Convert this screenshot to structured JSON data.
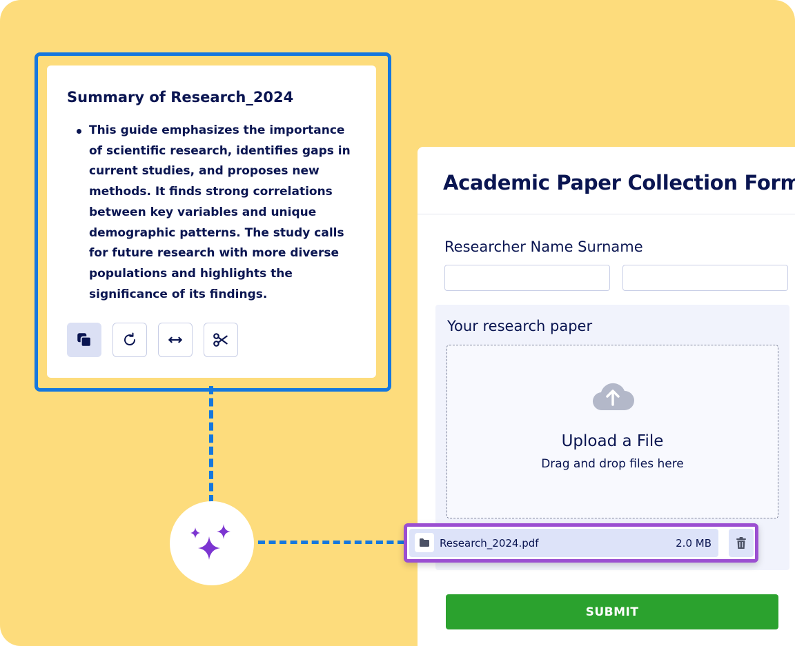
{
  "summary": {
    "title": "Summary of Research_2024",
    "bullets": [
      "This guide emphasizes the importance of scientific research, identifies gaps in current studies, and proposes new methods. It finds strong correlations between key variables and unique demographic patterns. The study calls for future research with more diverse populations and highlights the significance of its findings."
    ],
    "tools": [
      {
        "icon": "copy-icon"
      },
      {
        "icon": "refresh-icon"
      },
      {
        "icon": "expand-icon"
      },
      {
        "icon": "scissors-icon"
      }
    ]
  },
  "ai_icon": "sparkles-icon",
  "form": {
    "title": "Academic Paper Collection Form",
    "name_label": "Researcher Name Surname",
    "first_name_value": "",
    "last_name_value": "",
    "upload": {
      "label": "Your research paper",
      "title": "Upload a File",
      "subtitle": "Drag and drop files here",
      "icon": "cloud-upload-icon"
    },
    "submit_label": "SUBMIT"
  },
  "file": {
    "name": "Research_2024.pdf",
    "size": "2.0 MB",
    "icon": "folder-icon",
    "delete_icon": "trash-icon"
  },
  "colors": {
    "background": "#fddc7c",
    "accent_blue": "#1577de",
    "accent_purple": "#9b4ed1",
    "submit_green": "#2ba22e",
    "text_navy": "#0a1551"
  }
}
